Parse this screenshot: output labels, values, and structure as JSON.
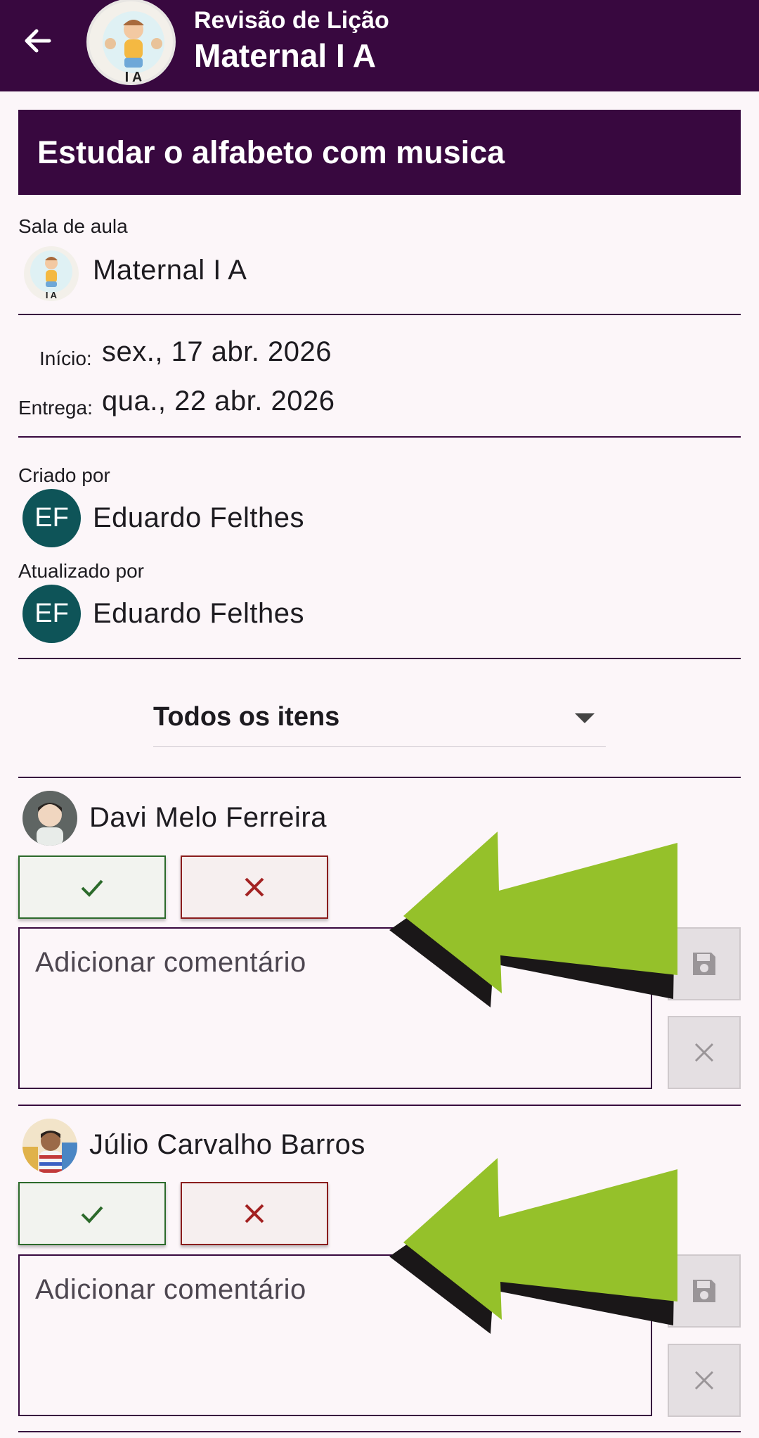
{
  "appbar": {
    "title_small": "Revisão de Lição",
    "title_large": "Maternal I A",
    "avatar_text": "I A"
  },
  "lesson": {
    "title": "Estudar o alfabeto com musica"
  },
  "classroom": {
    "label": "Sala de aula",
    "name": "Maternal I A",
    "avatar_text": "I A"
  },
  "dates": {
    "start_label": "Início:",
    "start_value": "sex., 17 abr. 2026",
    "due_label": "Entrega:",
    "due_value": "qua., 22 abr. 2026"
  },
  "created_by": {
    "label": "Criado por",
    "initials": "EF",
    "name": "Eduardo Felthes"
  },
  "updated_by": {
    "label": "Atualizado por",
    "initials": "EF",
    "name": "Eduardo Felthes"
  },
  "filter": {
    "selected": "Todos os itens"
  },
  "students": [
    {
      "name": "Davi Melo Ferreira",
      "comment_placeholder": "Adicionar comentário"
    },
    {
      "name": "Júlio Carvalho Barros",
      "comment_placeholder": "Adicionar comentário"
    }
  ],
  "colors": {
    "primary": "#38083f",
    "avatar_bg": "#0e5458",
    "approve": "#2c6a2b",
    "reject": "#8a1d1d",
    "annotation_arrow": "#95c12a"
  },
  "icons": {
    "back": "arrow-left-icon",
    "approve": "check-icon",
    "reject": "close-icon",
    "save": "save-icon",
    "clear": "close-icon"
  }
}
